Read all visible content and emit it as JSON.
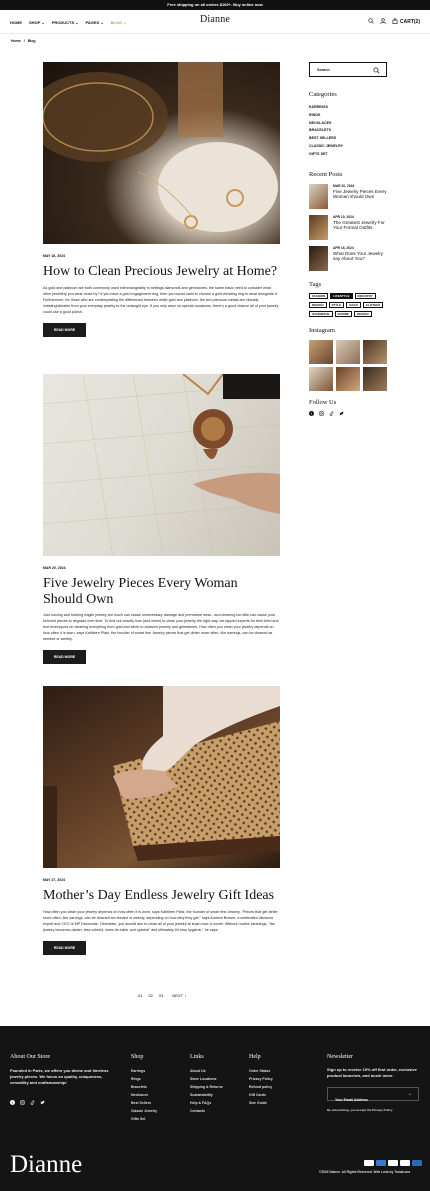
{
  "announcement": "Free shipping on all orders $100+. Buy online now",
  "brand": "Dianne",
  "nav": {
    "items": [
      "HOME",
      "SHOP",
      "PRODUCTS",
      "PAGES",
      "BLOG"
    ],
    "cart": "CART(2)"
  },
  "breadcrumb": {
    "home": "Home",
    "sep": "/",
    "current": "Blog"
  },
  "posts": [
    {
      "date": "MAY 16, 2024",
      "title": "How to Clean Precious Jewelry at Home?",
      "excerpt": "As gold and platinum are both commonly used interchangeably in settings diamonds and gemstones, the same basic need to consider what other jewellery you wear close by? If you have a gold engagement ring, then you would want to choose a gold wedding ring to wear alongside it. Furthermore, for those who are contemplating the differences between white gold and platinum, the two precious metals are virtually indistinguishable from your everyday jewelry to the untaught eye. If you only wear on special occasions, there's a good chance all of your jewelry could use a good polish.",
      "button": "READ MORE"
    },
    {
      "date": "MAR 20, 2024",
      "title": "Five Jewelry Pieces Every Woman Should Own",
      "excerpt": "Just moving and rubbing fragile jewelry too much can cause unnecessary damage and premature wear - and cleaning too little can cause your beloved pieces to degrade over time. To find out exactly how (and when) to clean your jewelry the right way, we tapped experts for their tried and true techniques on cleaning everything from gold and silver to costume jewelry and gemstones. How often you clean your jewelry depends on how often it is worn, says Kathleen Platz, the founder of smart fine Jewelry pieces that get dirtier more often, like earrings, can be cleaned as needed or weekly.",
      "button": "READ MORE"
    },
    {
      "date": "MAY 27, 2024",
      "title": "Mother’s Day Endless Jewelry Gift Ideas",
      "excerpt": "How often you clean your jewelry depends on how often it is worn, says Kathleen Platz, the founder of smart fine Jewelry. \"Pieces that get dirtier more often, like earrings, can be cleaned as needed or weekly, depending on how dirty they get,\" says Andrew Brewer, a celebrated diamond expert and CEO of MP Diamonds. Otherwise, you should aim to clean all of your jewelry at least once a month. Without routine cleanings, \"the jewelry becomes darker, less colorful, loses its luster and sparkle\" and ultimately it's less hygienic,\" he says.",
      "button": "READ MORE"
    }
  ],
  "pagination": {
    "pages": [
      "01",
      "02",
      "03"
    ],
    "next": "NEXT"
  },
  "sidebar": {
    "search_placeholder": "Search",
    "categories_title": "Categories",
    "categories": [
      "EARRINGS",
      "RINGS",
      "NECKLACES",
      "BRACELETS",
      "BEST SELLERS",
      "CLASSIC JEWELRY",
      "GIFTS SET"
    ],
    "recent_title": "Recent Posts",
    "recent": [
      {
        "date": "MAR 20, 2024",
        "title": "Five Jewelry Pieces Every Woman should Own"
      },
      {
        "date": "APR 10, 2024",
        "title": "The Greatest Jewelry For Your Formal Outfits"
      },
      {
        "date": "APR 16, 2024",
        "title": "What Does Your Jewelry say About You?"
      }
    ],
    "tags_title": "Tags",
    "tags": [
      "FASHION",
      "LIFESTYLE",
      "INDUSTRY",
      "DESIGN",
      "STYLE",
      "GOLD",
      "CLOTHES",
      "HANDMADE",
      "DIANNE",
      "DESIGN"
    ],
    "active_tag": "LIFESTYLE",
    "instagram_title": "Instagram",
    "follow_title": "Follow Us"
  },
  "footer": {
    "about_title": "About Our Store",
    "about_text": "Founded in Paris, we offers you divine and timeless jewelry pieces. We focus on quality, uniqueness, versatility and craftsmanship!",
    "shop_title": "Shop",
    "shop_links": [
      "Earrings",
      "Rings",
      "Bracelets",
      "Necklaces",
      "Best Sellers",
      "Classic Jewelry",
      "Gifts Set"
    ],
    "links_title": "Links",
    "links": [
      "About Us",
      "Store Locations",
      "Shipping & Returns",
      "Sustainability",
      "Help & FAQs",
      "Contacts"
    ],
    "help_title": "Help",
    "help_links": [
      "Order Status",
      "Privacy Policy",
      "Refund policy",
      "Gift Cards",
      "Size Guide"
    ],
    "newsletter_title": "Newsletter",
    "newsletter_text": "Sign up to receive 10% off first order, exclusive product launches, and much more.",
    "email_placeholder": "Your Email Address",
    "privacy": "By subscribing, you accept the Privacy Policy",
    "copyright": "©2024 Dianne. All Rights Reserved. Web Look by TomaLuna"
  },
  "colors": {
    "accent": "#b89a6b",
    "footer_bg": "#141414",
    "button_bg": "#1c1c1c"
  }
}
